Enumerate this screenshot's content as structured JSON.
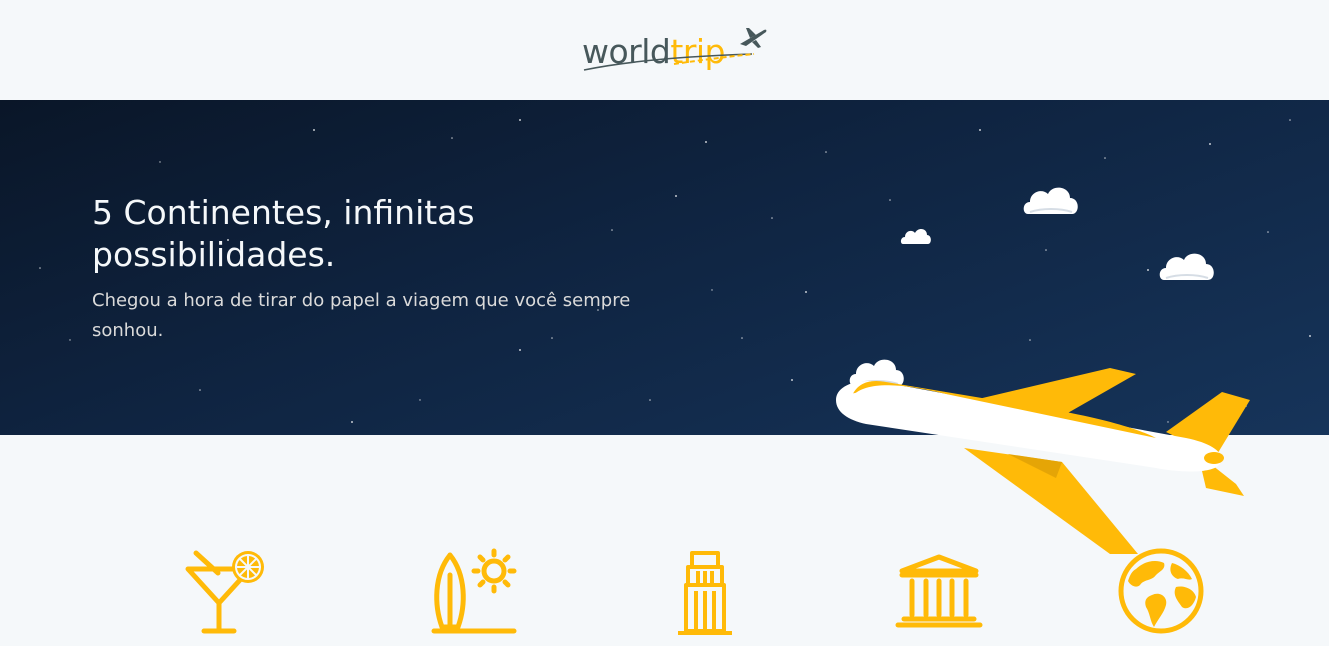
{
  "header": {
    "logo": {
      "word": "world",
      "accent": "trip"
    }
  },
  "banner": {
    "title": "5 Continentes, infinitas possibilidades.",
    "subtitle": "Chegou a hora de tirar do papel a viagem que você sempre sonhou.",
    "illustration": "airplane-with-clouds"
  },
  "travel_types": {
    "icons": [
      "cocktail-icon",
      "surf-icon",
      "building-icon",
      "museum-icon",
      "earth-icon"
    ]
  },
  "colors": {
    "background": "#F5F8FA",
    "banner": "#0f2441",
    "accent": "#FFBA08",
    "dark_text": "#47585B",
    "light_text": "#F5F8FA"
  }
}
